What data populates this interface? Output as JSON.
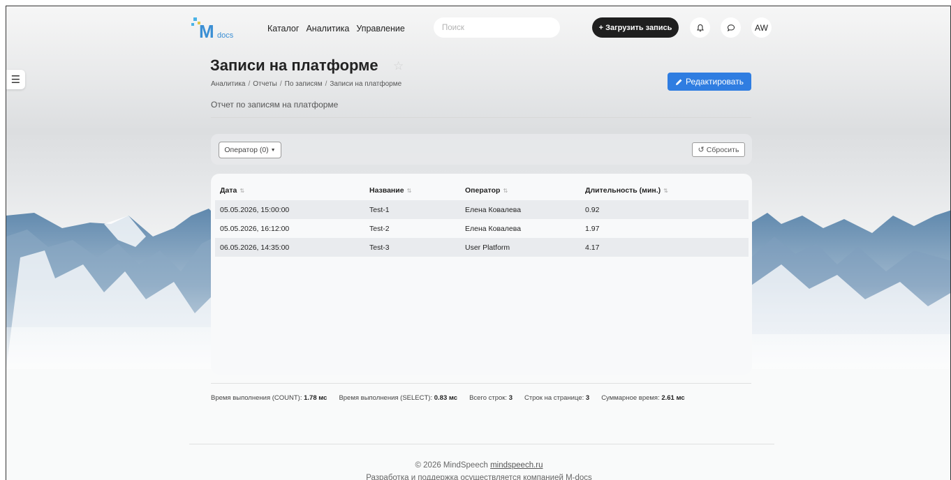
{
  "header": {
    "logo_text": "docs",
    "nav": [
      "Каталог",
      "Аналитика",
      "Управление"
    ],
    "search_placeholder": "Поиск",
    "upload_label": "+ Загрузить запись",
    "avatar_initials": "AW",
    "icons": {
      "notifications": "bell-icon",
      "messages": "chat-bubble-icon",
      "sidebar": "hamburger-icon"
    }
  },
  "page": {
    "title": "Записи на платформе",
    "breadcrumb": [
      "Аналитика",
      "Отчеты",
      "По записям",
      "Записи на платформе"
    ],
    "subtitle": "Отчет по записям на платформе",
    "edit_label": "Редактировать"
  },
  "filters": {
    "operator_label": "Оператор (0)",
    "reset_label": "Сбросить"
  },
  "table": {
    "columns": [
      "Дата",
      "Название",
      "Оператор",
      "Длительность (мин.)"
    ],
    "rows": [
      [
        "05.05.2026, 15:00:00",
        "Test-1",
        "Елена Ковалева",
        "0.92"
      ],
      [
        "05.05.2026, 16:12:00",
        "Test-2",
        "Елена Ковалева",
        "1.97"
      ],
      [
        "06.05.2026, 14:35:00",
        "Test-3",
        "User Platform",
        "4.17"
      ]
    ]
  },
  "stats": [
    {
      "label": "Время выполнения (COUNT):",
      "value": "1.78 мс"
    },
    {
      "label": "Время выполнения (SELECT):",
      "value": "0.83 мс"
    },
    {
      "label": "Всего строк:",
      "value": "3"
    },
    {
      "label": "Строк на странице:",
      "value": "3"
    },
    {
      "label": "Суммарное время:",
      "value": "2.61 мс"
    }
  ],
  "footer": {
    "copyright": "© 2026 MindSpeech",
    "link": "mindspeech.ru",
    "support": "Разработка и поддержка осуществляется компанией M-docs"
  },
  "colors": {
    "accent": "#2f7de1",
    "dark_button": "#1f1f1f"
  }
}
